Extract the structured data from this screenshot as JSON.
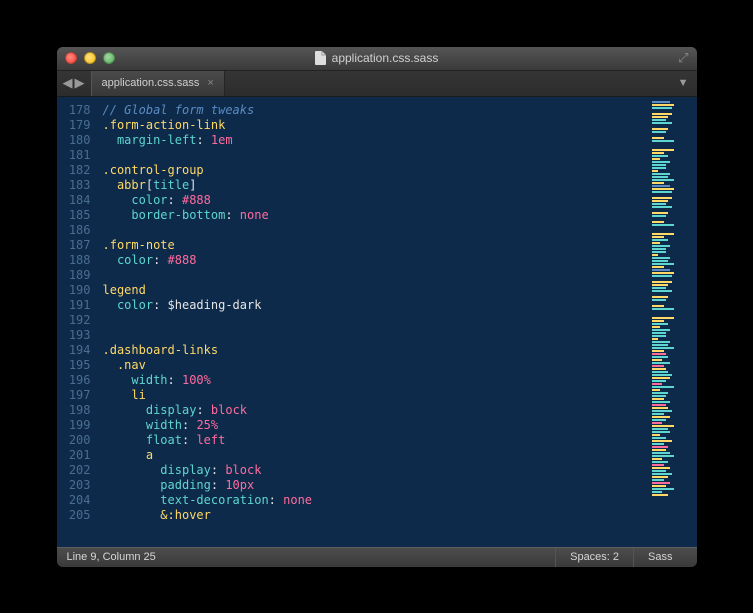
{
  "window": {
    "title": "application.css.sass"
  },
  "tabs": {
    "active": "application.css.sass"
  },
  "status": {
    "position": "Line 9, Column 25",
    "spaces": "Spaces: 2",
    "syntax": "Sass"
  },
  "gutter_start": 178,
  "lines": [
    [
      [
        "cm",
        "// Global form tweaks"
      ]
    ],
    [
      [
        "sel",
        ".form-action-link"
      ]
    ],
    [
      [
        "",
        "  "
      ],
      [
        "prop",
        "margin-left"
      ],
      [
        "",
        ": "
      ],
      [
        "num",
        "1em"
      ]
    ],
    [],
    [
      [
        "sel",
        ".control-group"
      ]
    ],
    [
      [
        "",
        "  "
      ],
      [
        "sel",
        "abbr"
      ],
      [
        "brkt",
        "["
      ],
      [
        "prop",
        "title"
      ],
      [
        "brkt",
        "]"
      ]
    ],
    [
      [
        "",
        "    "
      ],
      [
        "prop",
        "color"
      ],
      [
        "",
        ": "
      ],
      [
        "val",
        "#888"
      ]
    ],
    [
      [
        "",
        "    "
      ],
      [
        "prop",
        "border-bottom"
      ],
      [
        "",
        ": "
      ],
      [
        "none",
        "none"
      ]
    ],
    [],
    [
      [
        "sel",
        ".form-note"
      ]
    ],
    [
      [
        "",
        "  "
      ],
      [
        "prop",
        "color"
      ],
      [
        "",
        ": "
      ],
      [
        "val",
        "#888"
      ]
    ],
    [],
    [
      [
        "sel",
        "legend"
      ]
    ],
    [
      [
        "",
        "  "
      ],
      [
        "prop",
        "color"
      ],
      [
        "",
        ": "
      ],
      [
        "",
        "$heading-dark"
      ]
    ],
    [],
    [],
    [
      [
        "sel",
        ".dashboard-links"
      ]
    ],
    [
      [
        "",
        "  "
      ],
      [
        "sel",
        ".nav"
      ]
    ],
    [
      [
        "",
        "    "
      ],
      [
        "prop",
        "width"
      ],
      [
        "",
        ": "
      ],
      [
        "num",
        "100%"
      ]
    ],
    [
      [
        "",
        "    "
      ],
      [
        "sel",
        "li"
      ]
    ],
    [
      [
        "",
        "      "
      ],
      [
        "prop",
        "display"
      ],
      [
        "",
        ": "
      ],
      [
        "none",
        "block"
      ]
    ],
    [
      [
        "",
        "      "
      ],
      [
        "prop",
        "width"
      ],
      [
        "",
        ": "
      ],
      [
        "num",
        "25%"
      ]
    ],
    [
      [
        "",
        "      "
      ],
      [
        "prop",
        "float"
      ],
      [
        "",
        ": "
      ],
      [
        "none",
        "left"
      ]
    ],
    [
      [
        "",
        "      "
      ],
      [
        "sel",
        "a"
      ]
    ],
    [
      [
        "",
        "        "
      ],
      [
        "prop",
        "display"
      ],
      [
        "",
        ": "
      ],
      [
        "none",
        "block"
      ]
    ],
    [
      [
        "",
        "        "
      ],
      [
        "prop",
        "padding"
      ],
      [
        "",
        ": "
      ],
      [
        "num",
        "10px"
      ]
    ],
    [
      [
        "",
        "        "
      ],
      [
        "prop",
        "text-decoration"
      ],
      [
        "",
        ": "
      ],
      [
        "none",
        "none"
      ]
    ],
    [
      [
        "",
        "        "
      ],
      [
        "sel",
        "&:hover"
      ]
    ]
  ],
  "minimap_rows": [
    [
      "#5a8bc2",
      18
    ],
    [
      "#ffd866",
      22
    ],
    [
      "#5ed6d0",
      20
    ],
    [
      "",
      0
    ],
    [
      "#ffd866",
      20
    ],
    [
      "#ffd866",
      16
    ],
    [
      "#5ed6d0",
      14
    ],
    [
      "#5ed6d0",
      20
    ],
    [
      "",
      0
    ],
    [
      "#ffd866",
      16
    ],
    [
      "#5ed6d0",
      14
    ],
    [
      "",
      0
    ],
    [
      "#ffd866",
      12
    ],
    [
      "#5ed6d0",
      22
    ],
    [
      "",
      0
    ],
    [
      "",
      0
    ],
    [
      "#ffd866",
      22
    ],
    [
      "#ffd866",
      12
    ],
    [
      "#5ed6d0",
      16
    ],
    [
      "#ffd866",
      8
    ],
    [
      "#5ed6d0",
      18
    ],
    [
      "#5ed6d0",
      14
    ],
    [
      "#5ed6d0",
      14
    ],
    [
      "#ffd866",
      6
    ],
    [
      "#5ed6d0",
      18
    ],
    [
      "#5ed6d0",
      16
    ],
    [
      "#5ed6d0",
      22
    ],
    [
      "#ffd866",
      12
    ],
    [
      "#5a8bc2",
      18
    ],
    [
      "#ffd866",
      22
    ],
    [
      "#5ed6d0",
      20
    ],
    [
      "",
      0
    ],
    [
      "#ffd866",
      20
    ],
    [
      "#ffd866",
      16
    ],
    [
      "#5ed6d0",
      14
    ],
    [
      "#5ed6d0",
      20
    ],
    [
      "",
      0
    ],
    [
      "#ffd866",
      16
    ],
    [
      "#5ed6d0",
      14
    ],
    [
      "",
      0
    ],
    [
      "#ffd866",
      12
    ],
    [
      "#5ed6d0",
      22
    ],
    [
      "",
      0
    ],
    [
      "",
      0
    ],
    [
      "#ffd866",
      22
    ],
    [
      "#ffd866",
      12
    ],
    [
      "#5ed6d0",
      16
    ],
    [
      "#ffd866",
      8
    ],
    [
      "#5ed6d0",
      18
    ],
    [
      "#5ed6d0",
      14
    ],
    [
      "#5ed6d0",
      14
    ],
    [
      "#ffd866",
      6
    ],
    [
      "#5ed6d0",
      18
    ],
    [
      "#5ed6d0",
      16
    ],
    [
      "#5ed6d0",
      22
    ],
    [
      "#ffd866",
      12
    ],
    [
      "#5a8bc2",
      18
    ],
    [
      "#ffd866",
      22
    ],
    [
      "#5ed6d0",
      20
    ],
    [
      "",
      0
    ],
    [
      "#ffd866",
      20
    ],
    [
      "#ffd866",
      16
    ],
    [
      "#5ed6d0",
      14
    ],
    [
      "#5ed6d0",
      20
    ],
    [
      "",
      0
    ],
    [
      "#ffd866",
      16
    ],
    [
      "#5ed6d0",
      14
    ],
    [
      "",
      0
    ],
    [
      "#ffd866",
      12
    ],
    [
      "#5ed6d0",
      22
    ],
    [
      "",
      0
    ],
    [
      "",
      0
    ],
    [
      "#ffd866",
      22
    ],
    [
      "#ffd866",
      12
    ],
    [
      "#5ed6d0",
      16
    ],
    [
      "#ffd866",
      8
    ],
    [
      "#5ed6d0",
      18
    ],
    [
      "#5ed6d0",
      14
    ],
    [
      "#5ed6d0",
      14
    ],
    [
      "#ffd866",
      6
    ],
    [
      "#5ed6d0",
      18
    ],
    [
      "#5ed6d0",
      16
    ],
    [
      "#5ed6d0",
      22
    ],
    [
      "#ffd866",
      12
    ],
    [
      "#ff6b9d",
      14
    ],
    [
      "#5ed6d0",
      16
    ],
    [
      "#ffd866",
      10
    ],
    [
      "#5ed6d0",
      18
    ],
    [
      "#ff6b9d",
      12
    ],
    [
      "#ffd866",
      14
    ],
    [
      "#5ed6d0",
      16
    ],
    [
      "#5ed6d0",
      20
    ],
    [
      "#ffd866",
      18
    ],
    [
      "#5ed6d0",
      14
    ],
    [
      "#ff6b9d",
      10
    ],
    [
      "#5ed6d0",
      22
    ],
    [
      "#ffd866",
      8
    ],
    [
      "#5ed6d0",
      16
    ],
    [
      "#5ed6d0",
      14
    ],
    [
      "#ffd866",
      12
    ],
    [
      "#5ed6d0",
      18
    ],
    [
      "#ff6b9d",
      14
    ],
    [
      "#ffd866",
      16
    ],
    [
      "#5ed6d0",
      20
    ],
    [
      "#5ed6d0",
      12
    ],
    [
      "#ffd866",
      18
    ],
    [
      "#5ed6d0",
      14
    ],
    [
      "#ff6b9d",
      10
    ],
    [
      "#ffd866",
      22
    ],
    [
      "#5ed6d0",
      16
    ],
    [
      "#5ed6d0",
      18
    ],
    [
      "#ffd866",
      8
    ],
    [
      "#5ed6d0",
      14
    ],
    [
      "#ffd866",
      20
    ],
    [
      "#5ed6d0",
      12
    ],
    [
      "#ff6b9d",
      16
    ],
    [
      "#ffd866",
      14
    ],
    [
      "#5ed6d0",
      18
    ],
    [
      "#5ed6d0",
      22
    ],
    [
      "#ffd866",
      10
    ],
    [
      "#5ed6d0",
      16
    ],
    [
      "#ff6b9d",
      12
    ],
    [
      "#ffd866",
      18
    ],
    [
      "#5ed6d0",
      14
    ],
    [
      "#5ed6d0",
      20
    ],
    [
      "#ffd866",
      16
    ],
    [
      "#5ed6d0",
      12
    ],
    [
      "#ff6b9d",
      18
    ],
    [
      "#ffd866",
      14
    ],
    [
      "#5ed6d0",
      22
    ],
    [
      "#5ed6d0",
      10
    ],
    [
      "#ffd866",
      16
    ]
  ]
}
